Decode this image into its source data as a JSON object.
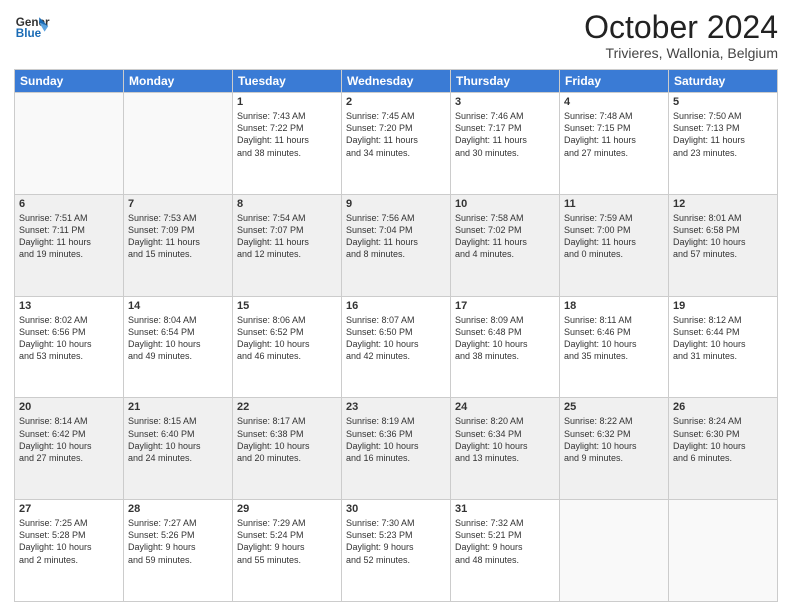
{
  "header": {
    "logo_line1": "General",
    "logo_line2": "Blue",
    "month": "October 2024",
    "location": "Trivieres, Wallonia, Belgium"
  },
  "weekdays": [
    "Sunday",
    "Monday",
    "Tuesday",
    "Wednesday",
    "Thursday",
    "Friday",
    "Saturday"
  ],
  "weeks": [
    [
      {
        "day": "",
        "info": ""
      },
      {
        "day": "",
        "info": ""
      },
      {
        "day": "1",
        "info": "Sunrise: 7:43 AM\nSunset: 7:22 PM\nDaylight: 11 hours\nand 38 minutes."
      },
      {
        "day": "2",
        "info": "Sunrise: 7:45 AM\nSunset: 7:20 PM\nDaylight: 11 hours\nand 34 minutes."
      },
      {
        "day": "3",
        "info": "Sunrise: 7:46 AM\nSunset: 7:17 PM\nDaylight: 11 hours\nand 30 minutes."
      },
      {
        "day": "4",
        "info": "Sunrise: 7:48 AM\nSunset: 7:15 PM\nDaylight: 11 hours\nand 27 minutes."
      },
      {
        "day": "5",
        "info": "Sunrise: 7:50 AM\nSunset: 7:13 PM\nDaylight: 11 hours\nand 23 minutes."
      }
    ],
    [
      {
        "day": "6",
        "info": "Sunrise: 7:51 AM\nSunset: 7:11 PM\nDaylight: 11 hours\nand 19 minutes."
      },
      {
        "day": "7",
        "info": "Sunrise: 7:53 AM\nSunset: 7:09 PM\nDaylight: 11 hours\nand 15 minutes."
      },
      {
        "day": "8",
        "info": "Sunrise: 7:54 AM\nSunset: 7:07 PM\nDaylight: 11 hours\nand 12 minutes."
      },
      {
        "day": "9",
        "info": "Sunrise: 7:56 AM\nSunset: 7:04 PM\nDaylight: 11 hours\nand 8 minutes."
      },
      {
        "day": "10",
        "info": "Sunrise: 7:58 AM\nSunset: 7:02 PM\nDaylight: 11 hours\nand 4 minutes."
      },
      {
        "day": "11",
        "info": "Sunrise: 7:59 AM\nSunset: 7:00 PM\nDaylight: 11 hours\nand 0 minutes."
      },
      {
        "day": "12",
        "info": "Sunrise: 8:01 AM\nSunset: 6:58 PM\nDaylight: 10 hours\nand 57 minutes."
      }
    ],
    [
      {
        "day": "13",
        "info": "Sunrise: 8:02 AM\nSunset: 6:56 PM\nDaylight: 10 hours\nand 53 minutes."
      },
      {
        "day": "14",
        "info": "Sunrise: 8:04 AM\nSunset: 6:54 PM\nDaylight: 10 hours\nand 49 minutes."
      },
      {
        "day": "15",
        "info": "Sunrise: 8:06 AM\nSunset: 6:52 PM\nDaylight: 10 hours\nand 46 minutes."
      },
      {
        "day": "16",
        "info": "Sunrise: 8:07 AM\nSunset: 6:50 PM\nDaylight: 10 hours\nand 42 minutes."
      },
      {
        "day": "17",
        "info": "Sunrise: 8:09 AM\nSunset: 6:48 PM\nDaylight: 10 hours\nand 38 minutes."
      },
      {
        "day": "18",
        "info": "Sunrise: 8:11 AM\nSunset: 6:46 PM\nDaylight: 10 hours\nand 35 minutes."
      },
      {
        "day": "19",
        "info": "Sunrise: 8:12 AM\nSunset: 6:44 PM\nDaylight: 10 hours\nand 31 minutes."
      }
    ],
    [
      {
        "day": "20",
        "info": "Sunrise: 8:14 AM\nSunset: 6:42 PM\nDaylight: 10 hours\nand 27 minutes."
      },
      {
        "day": "21",
        "info": "Sunrise: 8:15 AM\nSunset: 6:40 PM\nDaylight: 10 hours\nand 24 minutes."
      },
      {
        "day": "22",
        "info": "Sunrise: 8:17 AM\nSunset: 6:38 PM\nDaylight: 10 hours\nand 20 minutes."
      },
      {
        "day": "23",
        "info": "Sunrise: 8:19 AM\nSunset: 6:36 PM\nDaylight: 10 hours\nand 16 minutes."
      },
      {
        "day": "24",
        "info": "Sunrise: 8:20 AM\nSunset: 6:34 PM\nDaylight: 10 hours\nand 13 minutes."
      },
      {
        "day": "25",
        "info": "Sunrise: 8:22 AM\nSunset: 6:32 PM\nDaylight: 10 hours\nand 9 minutes."
      },
      {
        "day": "26",
        "info": "Sunrise: 8:24 AM\nSunset: 6:30 PM\nDaylight: 10 hours\nand 6 minutes."
      }
    ],
    [
      {
        "day": "27",
        "info": "Sunrise: 7:25 AM\nSunset: 5:28 PM\nDaylight: 10 hours\nand 2 minutes."
      },
      {
        "day": "28",
        "info": "Sunrise: 7:27 AM\nSunset: 5:26 PM\nDaylight: 9 hours\nand 59 minutes."
      },
      {
        "day": "29",
        "info": "Sunrise: 7:29 AM\nSunset: 5:24 PM\nDaylight: 9 hours\nand 55 minutes."
      },
      {
        "day": "30",
        "info": "Sunrise: 7:30 AM\nSunset: 5:23 PM\nDaylight: 9 hours\nand 52 minutes."
      },
      {
        "day": "31",
        "info": "Sunrise: 7:32 AM\nSunset: 5:21 PM\nDaylight: 9 hours\nand 48 minutes."
      },
      {
        "day": "",
        "info": ""
      },
      {
        "day": "",
        "info": ""
      }
    ]
  ]
}
